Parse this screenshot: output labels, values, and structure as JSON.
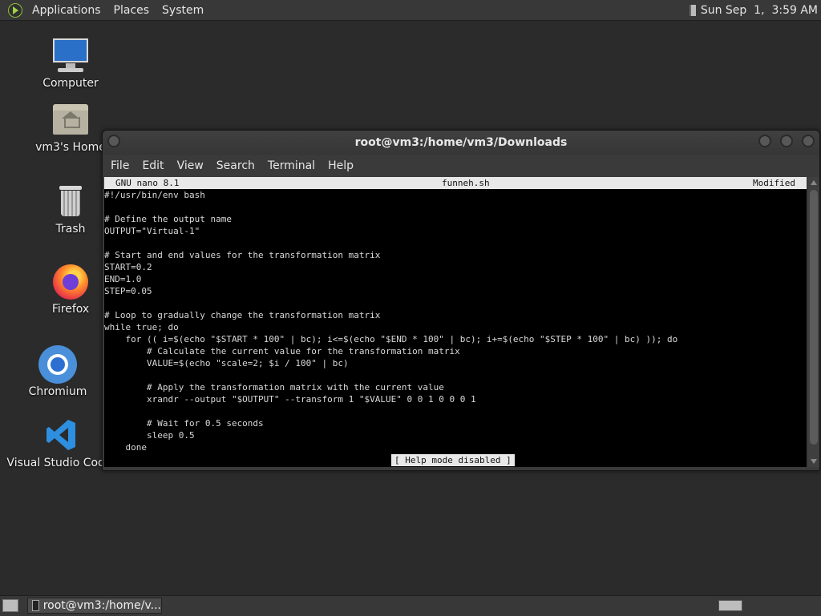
{
  "top_panel": {
    "menu": [
      "Applications",
      "Places",
      "System"
    ],
    "clock": "Sun Sep  1,  3:59 AM"
  },
  "desktop": {
    "icons": [
      "Computer",
      "vm3's Home",
      "Trash",
      "Firefox",
      "Chromium",
      "Visual Studio Code"
    ]
  },
  "terminal": {
    "title": "root@vm3:/home/vm3/Downloads",
    "menu": [
      "File",
      "Edit",
      "View",
      "Search",
      "Terminal",
      "Help"
    ],
    "nano": {
      "version": "GNU nano 8.1",
      "filename": "funneh.sh",
      "state": "Modified",
      "status_message": "[ Help mode disabled ]",
      "lines": [
        "#!/usr/bin/env bash",
        "",
        "# Define the output name",
        "OUTPUT=\"Virtual-1\"",
        "",
        "# Start and end values for the transformation matrix",
        "START=0.2",
        "END=1.0",
        "STEP=0.05",
        "",
        "# Loop to gradually change the transformation matrix",
        "while true; do",
        "    for (( i=$(echo \"$START * 100\" | bc); i<=$(echo \"$END * 100\" | bc); i+=$(echo \"$STEP * 100\" | bc) )); do",
        "        # Calculate the current value for the transformation matrix",
        "        VALUE=$(echo \"scale=2; $i / 100\" | bc)",
        "",
        "        # Apply the transformation matrix with the current value",
        "        xrandr --output \"$OUTPUT\" --transform 1 \"$VALUE\" 0 0 1 0 0 0 1",
        "",
        "        # Wait for 0.5 seconds",
        "        sleep 0.5",
        "    done"
      ]
    }
  },
  "taskbar": {
    "window_label": "root@vm3:/home/v..."
  }
}
